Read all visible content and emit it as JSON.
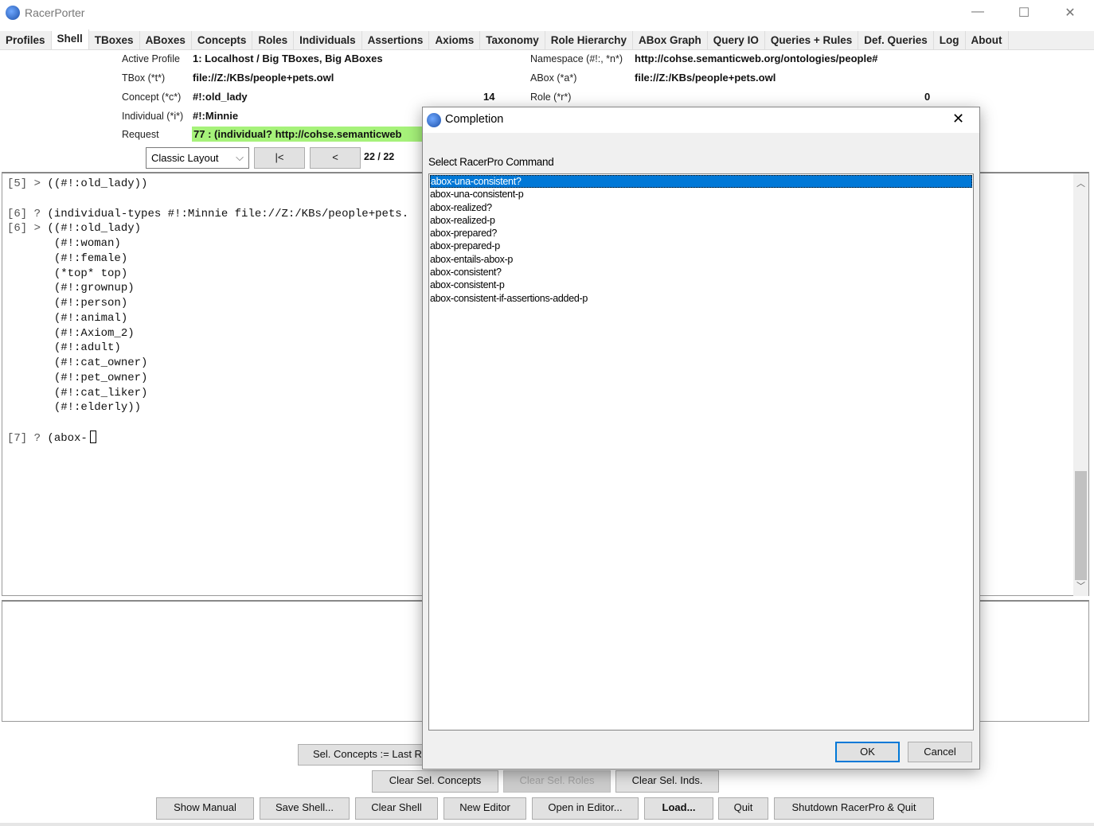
{
  "window": {
    "title": "RacerPorter",
    "minimize": "—",
    "maximize": "☐",
    "close": "✕"
  },
  "tabs": [
    "Profiles",
    "Shell",
    "TBoxes",
    "ABoxes",
    "Concepts",
    "Roles",
    "Individuals",
    "Assertions",
    "Axioms",
    "Taxonomy",
    "Role Hierarchy",
    "ABox Graph",
    "Query IO",
    "Queries + Rules",
    "Def. Queries",
    "Log",
    "About"
  ],
  "active_tab": "Shell",
  "info": {
    "active_profile_label": "Active Profile",
    "active_profile": "1: Localhost / Big TBoxes, Big ABoxes",
    "tbox_label": "TBox (*t*)",
    "tbox": "file://Z:/KBs/people+pets.owl",
    "concept_label": "Concept (*c*)",
    "concept": "#!:old_lady",
    "concept_count": "14",
    "individual_label": "Individual (*i*)",
    "individual": "#!:Minnie",
    "request_label": "Request",
    "request": "77 : (individual? http://cohse.semanticweb",
    "namespace_label": "Namespace (#!:, *n*)",
    "namespace": "http://cohse.semanticweb.org/ontologies/people#",
    "abox_label": "ABox (*a*)",
    "abox": "file://Z:/KBs/people+pets.owl",
    "role_label": "Role (*r*)",
    "role_count": "0"
  },
  "controls": {
    "layout": "Classic Layout",
    "first": "|<",
    "prev": "<",
    "position": "22 / 22"
  },
  "shell": [
    {
      "prompt": "[5] >",
      "text": "((#!:old_lady))",
      "color": "#e8a44c"
    },
    {
      "prompt": "",
      "text": "",
      "color": "#000"
    },
    {
      "prompt": "[6] ?",
      "text": "(individual-types #!:Minnie file://Z:/KBs/people+pets.",
      "color": "#c77ad8"
    },
    {
      "prompt": "[6] >",
      "text": "((#!:old_lady)",
      "color": "#e66"
    },
    {
      "prompt": "",
      "text": " (#!:woman)",
      "color": "#3a9"
    },
    {
      "prompt": "",
      "text": " (#!:female)",
      "color": "#e8a44c"
    },
    {
      "prompt": "",
      "text": " (*top* top)",
      "color": "#36c"
    },
    {
      "prompt": "",
      "text": " (#!:grownup)",
      "color": "#c77ad8"
    },
    {
      "prompt": "",
      "text": " (#!:person)",
      "color": "#e44"
    },
    {
      "prompt": "",
      "text": " (#!:animal)",
      "color": "#333"
    },
    {
      "prompt": "",
      "text": " (#!:Axiom_2)",
      "color": "#3a9"
    },
    {
      "prompt": "",
      "text": " (#!:adult)",
      "color": "#e8a44c"
    },
    {
      "prompt": "",
      "text": " (#!:cat_owner)",
      "color": "#36c"
    },
    {
      "prompt": "",
      "text": " (#!:pet_owner)",
      "color": "#c77ad8"
    },
    {
      "prompt": "",
      "text": " (#!:cat_liker)",
      "color": "#e44"
    },
    {
      "prompt": "",
      "text": " (#!:elderly))",
      "color": "#e44"
    },
    {
      "prompt": "",
      "text": "",
      "color": "#000"
    },
    {
      "prompt": "[7] ?",
      "text": "(abox-",
      "color": "#e8a44c"
    }
  ],
  "buttons": {
    "sel_concepts": "Sel. Concepts := Last R",
    "clear_sel_concepts": "Clear Sel. Concepts",
    "clear_sel_roles": "Clear Sel. Roles",
    "clear_sel_inds": "Clear Sel. Inds.",
    "show_manual": "Show Manual",
    "save_shell": "Save Shell...",
    "clear_shell": "Clear Shell",
    "new_editor": "New Editor",
    "open_in_editor": "Open in Editor...",
    "load": "Load...",
    "quit": "Quit",
    "shutdown": "Shutdown RacerPro & Quit"
  },
  "dialog": {
    "title": "Completion",
    "label": "Select RacerPro Command",
    "ok": "OK",
    "cancel": "Cancel",
    "selected": 0,
    "items": [
      "abox-una-consistent?",
      "abox-una-consistent-p",
      "abox-realized?",
      "abox-realized-p",
      "abox-prepared?",
      "abox-prepared-p",
      "abox-entails-abox-p",
      "abox-consistent?",
      "abox-consistent-p",
      "abox-consistent-if-assertions-added-p"
    ]
  },
  "colors": {
    "request_bg": "#a6f27a",
    "selection": "#0078d7",
    "ok_border": "#0078d7"
  }
}
